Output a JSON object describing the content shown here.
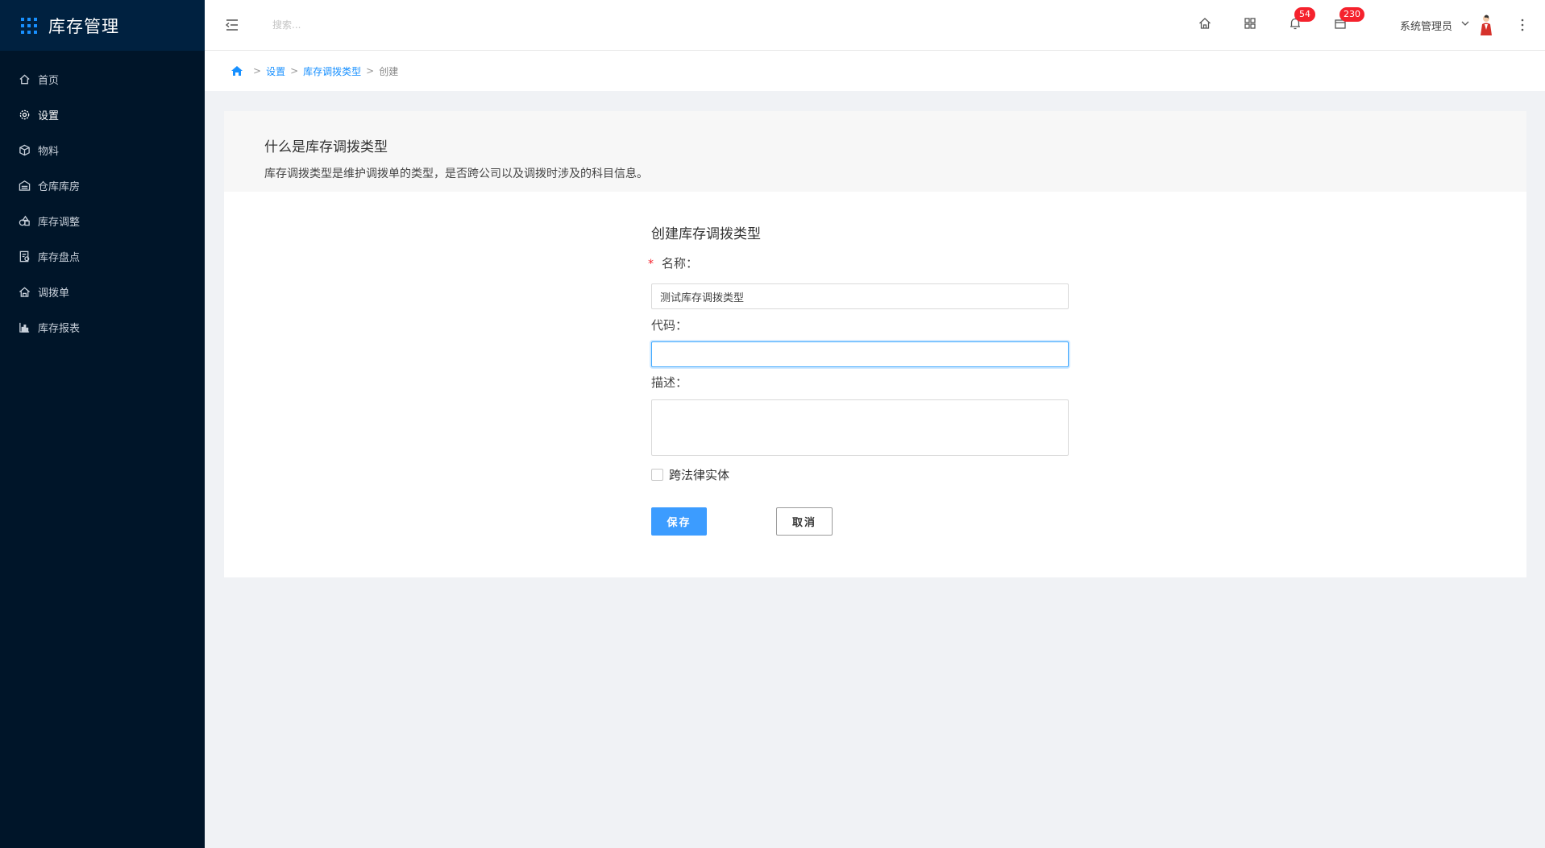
{
  "app": {
    "title": "库存管理"
  },
  "sidebar": {
    "items": [
      {
        "label": "首页",
        "icon": "home-icon"
      },
      {
        "label": "设置",
        "icon": "gear-icon"
      },
      {
        "label": "物料",
        "icon": "cube-icon"
      },
      {
        "label": "仓库库房",
        "icon": "warehouse-icon"
      },
      {
        "label": "库存调整",
        "icon": "adjust-icon"
      },
      {
        "label": "库存盘点",
        "icon": "inventory-check-icon"
      },
      {
        "label": "调拨单",
        "icon": "transfer-icon"
      },
      {
        "label": "库存报表",
        "icon": "bar-chart-icon"
      }
    ],
    "active_index": 1
  },
  "header": {
    "search_placeholder": "搜索...",
    "notifications_count": "54",
    "messages_count": "230",
    "user_name": "系统管理员"
  },
  "breadcrumb": {
    "items": [
      "设置",
      "库存调拨类型",
      "创建"
    ]
  },
  "info": {
    "title": "什么是库存调拨类型",
    "description": "库存调拨类型是维护调拨单的类型，是否跨公司以及调拨时涉及的科目信息。"
  },
  "form": {
    "title": "创建库存调拨类型",
    "name_label": "名称：",
    "name_value": "测试库存调拨类型",
    "code_label": "代码：",
    "code_value": "",
    "description_label": "描述：",
    "cross_entity_label": "跨法律实体",
    "save_label": "保存",
    "cancel_label": "取消"
  },
  "colors": {
    "sidebar_bg": "#001529",
    "accent": "#1890ff",
    "badge": "#f5222d",
    "primary_button": "#3c9cff"
  }
}
